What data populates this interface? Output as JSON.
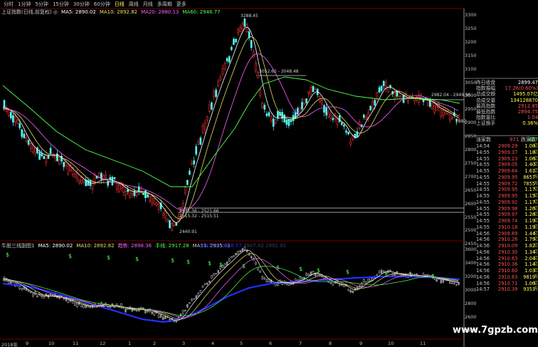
{
  "toolbar": {
    "items": [
      "分时",
      "1分钟",
      "5分钟",
      "15分钟",
      "30分钟",
      "60分钟",
      "日线",
      "周线",
      "月线",
      "多周期",
      "更多"
    ],
    "active_index": 6
  },
  "index_title": {
    "name": "上证指数(日线,前复权) ◎",
    "ma5": "MA5: 2890.02",
    "ma10": "MA10: 2892.82",
    "ma20": "MA20: 2880.13",
    "ma60": "MA60: 2946.77"
  },
  "indicator_title": {
    "name": "牛股三线副图1",
    "ma5": "MA5: 2890.02",
    "ma10": "MA10: 2892.82",
    "trend": "趋势: 2898.36",
    "hand": "手线: 2917.28",
    "ma51": "MA51: 2935.83",
    "extra1": "MA117: 2848.57",
    "extra2": "2907.62",
    "extra3": "2892.82"
  },
  "annotations": {
    "high": "3288.45",
    "mid": "3052.62 - 3048.48",
    "right": "2982.04 - 2949.96",
    "low1": "2531.36 - 2521.66",
    "low2": "2515.32 - 2515.51",
    "low_point": "2440.91",
    "last": "2882"
  },
  "price_axis": [
    "3300",
    "3250",
    "3200",
    "3150",
    "3100",
    "3050",
    "3000",
    "2950",
    "2900",
    "2850",
    "2800",
    "2750",
    "2700",
    "2650",
    "2600",
    "2550",
    "2500",
    "2450"
  ],
  "ind_axis": [
    "3600",
    "3400",
    "3200",
    "3000",
    "2800",
    "2600",
    "2400"
  ],
  "dates": [
    "2018年",
    "9",
    "10",
    "11",
    "12",
    "1",
    "2",
    "3",
    "4",
    "5",
    "6",
    "7",
    "8",
    "9",
    "10",
    "11"
  ],
  "quote_panel": [
    {
      "k": "昨日收盘",
      "v": "2899.47",
      "c": "#ffffff"
    },
    {
      "k": "指数振幅",
      "v": "17.26(0.60%)",
      "c": "#ff5050"
    },
    {
      "k": "总成交额",
      "v": "1495.07亿",
      "c": "#ffff50"
    },
    {
      "k": "总成交量",
      "v": "134128870",
      "c": "#ffff50"
    },
    {
      "k": "最高指数",
      "v": "2912.85",
      "c": "#ff5050"
    },
    {
      "k": "最低指数",
      "v": "2894.75",
      "c": "#ff5050"
    },
    {
      "k": "指数量比",
      "v": "1.04",
      "c": "#ff5050"
    },
    {
      "k": "上证换手",
      "v": "0.36%",
      "c": "#ffff50"
    }
  ],
  "breadth": {
    "up_label": "涨家数",
    "up": "971",
    "down_label": "跌家数",
    "down": "407"
  },
  "ticks": [
    {
      "t": "14:54",
      "p": "2909.29",
      "q": "1.08",
      "u": "亿"
    },
    {
      "t": "14:55",
      "p": "2909.37",
      "q": "1.18",
      "u": "亿"
    },
    {
      "t": "14:55",
      "p": "2909.23",
      "q": "1.06",
      "u": "亿"
    },
    {
      "t": "14:55",
      "p": "2909.05",
      "q": "1.40",
      "u": "亿"
    },
    {
      "t": "14:55",
      "p": "2909.64",
      "q": "1.61",
      "u": "亿"
    },
    {
      "t": "14:55",
      "p": "2909.95",
      "q": "8657",
      "u": "万"
    },
    {
      "t": "14:55",
      "p": "2909.72",
      "q": "7855",
      "u": "万"
    },
    {
      "t": "14:55",
      "p": "2909.95",
      "q": "1.17",
      "u": "亿"
    },
    {
      "t": "14:55",
      "p": "2909.95",
      "q": "1.15",
      "u": "亿"
    },
    {
      "t": "14:55",
      "p": "2909.92",
      "q": "1.17",
      "u": "亿"
    },
    {
      "t": "14:55",
      "p": "2909.98",
      "q": "1.26",
      "u": "亿"
    },
    {
      "t": "14:55",
      "p": "2909.97",
      "q": "1.28",
      "u": "亿"
    },
    {
      "t": "14:55",
      "p": "2909.74",
      "q": "1.19",
      "u": "亿"
    },
    {
      "t": "14:55",
      "p": "2910.18",
      "q": "1.19",
      "u": "亿"
    },
    {
      "t": "14:56",
      "p": "2909.89",
      "q": "1.44",
      "u": "亿"
    },
    {
      "t": "14:56",
      "p": "2910.26",
      "q": "1.79",
      "u": "亿"
    },
    {
      "t": "14:56",
      "p": "2910.09",
      "q": "1.82",
      "u": "亿"
    },
    {
      "t": "14:56",
      "p": "2910.30",
      "q": "1.34",
      "u": "亿"
    },
    {
      "t": "14:56",
      "p": "2910.63",
      "q": "2.04",
      "u": "亿"
    },
    {
      "t": "14:56",
      "p": "2910.36",
      "q": "1.14",
      "u": "亿"
    },
    {
      "t": "14:56",
      "p": "2910.60",
      "q": "1.03",
      "u": "亿"
    },
    {
      "t": "14:56",
      "p": "2910.63",
      "q": "9819",
      "u": "万"
    },
    {
      "t": "14:56",
      "p": "2910.71",
      "q": "1.06",
      "u": "亿"
    },
    {
      "t": "14:57",
      "p": "2910.39",
      "q": "9353",
      "u": "万"
    }
  ],
  "colors": {
    "up": "#ff3232",
    "down": "#54fcfc",
    "ma5": "#ffffff",
    "ma10": "#e0e060",
    "ma20": "#ff60ff",
    "ma60": "#50ff50",
    "blue_line": "#2030ff"
  },
  "watermark": "www.7gpzb.com"
}
